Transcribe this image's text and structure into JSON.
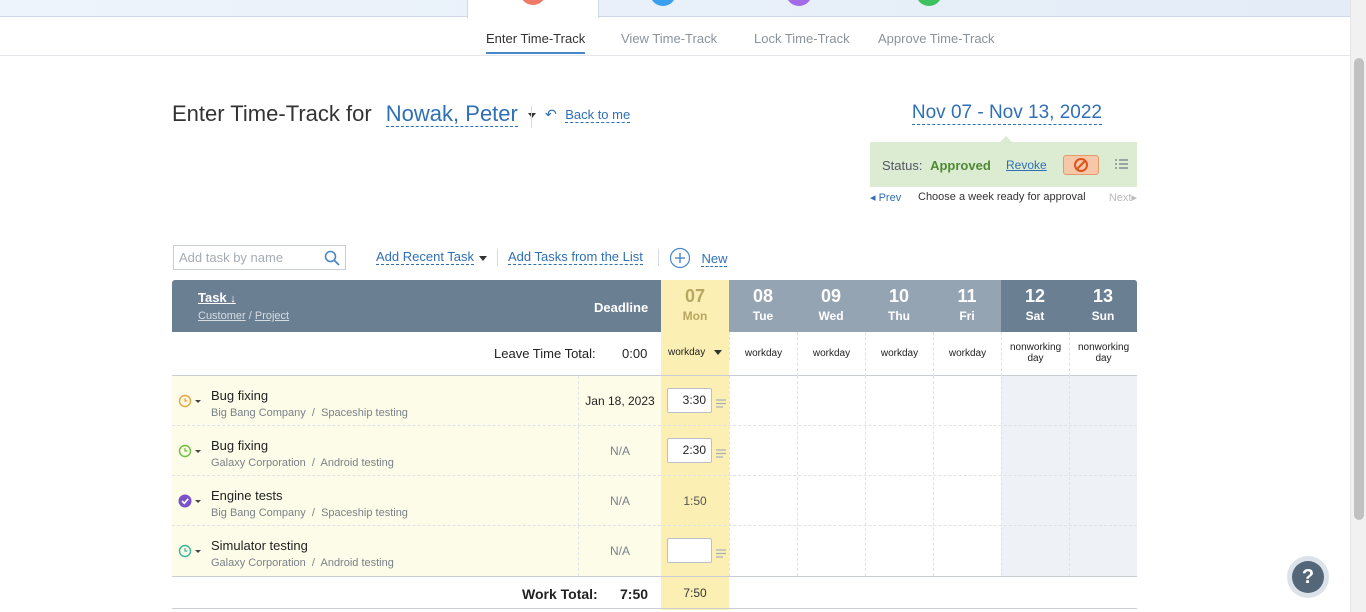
{
  "subnav": {
    "tabs": [
      {
        "label": "Enter Time-Track"
      },
      {
        "label": "View Time-Track"
      },
      {
        "label": "Lock Time-Track"
      },
      {
        "label": "Approve Time-Track"
      }
    ]
  },
  "header": {
    "title_prefix": "Enter Time-Track for",
    "user": "Nowak, Peter",
    "back_label": "Back to me",
    "period": "Nov 07 - Nov 13, 2022"
  },
  "status": {
    "label": "Status:",
    "value": "Approved",
    "revoke_label": "Revoke",
    "prev_label": "Prev",
    "message": "Choose a week ready for approval",
    "next_label": "Next"
  },
  "toolbar": {
    "search_placeholder": "Add task by name",
    "add_recent_label": "Add Recent Task",
    "add_from_list_label": "Add Tasks from the List",
    "new_label": "New"
  },
  "grid": {
    "task_header": "Task",
    "customer_header": "Customer",
    "project_header": "Project",
    "path_sep": "/",
    "deadline_header": "Deadline",
    "days": [
      {
        "num": "07",
        "name": "Mon",
        "kind": "workday"
      },
      {
        "num": "08",
        "name": "Tue",
        "kind": "workday"
      },
      {
        "num": "09",
        "name": "Wed",
        "kind": "workday"
      },
      {
        "num": "10",
        "name": "Thu",
        "kind": "workday"
      },
      {
        "num": "11",
        "name": "Fri",
        "kind": "workday"
      },
      {
        "num": "12",
        "name": "Sat",
        "kind": "nonworking day"
      },
      {
        "num": "13",
        "name": "Sun",
        "kind": "nonworking day"
      }
    ],
    "leave_label": "Leave Time Total:",
    "leave_value": "0:00",
    "rows": [
      {
        "name": "Bug fixing",
        "customer": "Big Bang Company",
        "project": "Spaceship testing",
        "deadline": "Jan 18, 2023",
        "mon": "3:30",
        "icon": "clock-orange-icon"
      },
      {
        "name": "Bug fixing",
        "customer": "Galaxy Corporation",
        "project": "Android testing",
        "deadline": "N/A",
        "mon": "2:30",
        "icon": "clock-green-icon"
      },
      {
        "name": "Engine tests",
        "customer": "Big Bang Company",
        "project": "Spaceship testing",
        "deadline": "N/A",
        "mon": "1:50",
        "icon": "check-purple-icon"
      },
      {
        "name": "Simulator testing",
        "customer": "Galaxy Corporation",
        "project": "Android testing",
        "deadline": "N/A",
        "mon": "",
        "icon": "clock-teal-icon"
      }
    ],
    "work_total_label": "Work Total:",
    "work_total_value": "7:50",
    "mon_total": "7:50"
  },
  "help": {
    "label": "?"
  },
  "colors": {
    "header_bg": "#6b7f92",
    "today_col": "#fbefb4",
    "accent": "#2f6fb6",
    "approved": "#4d8a33"
  }
}
